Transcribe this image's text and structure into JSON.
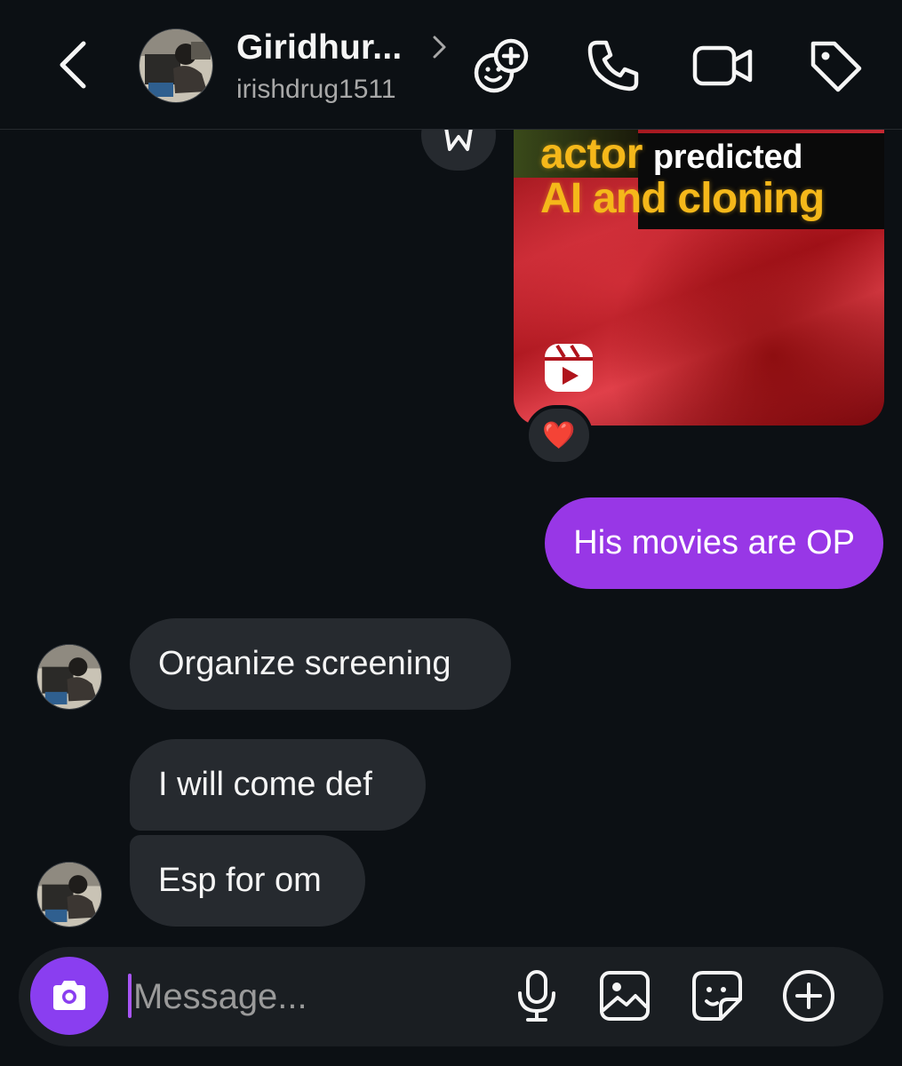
{
  "header": {
    "name": "Giridhur...",
    "username": "irishdrug1511",
    "icons": [
      "back-chevron-icon",
      "chevron-right-icon",
      "gaming-icon",
      "phone-icon",
      "video-camera-icon",
      "tag-icon"
    ]
  },
  "reel": {
    "word_actor": "actor",
    "word_predicted": "predicted",
    "line_two": "AI and cloning",
    "icon": "reels-icon"
  },
  "reaction": {
    "emoji": "❤️"
  },
  "messages": {
    "outgoing": [
      {
        "text": "His movies are OP"
      }
    ],
    "incoming": [
      {
        "text": "Organize screening"
      },
      {
        "text": "I will come def"
      },
      {
        "text": "Esp for om"
      }
    ]
  },
  "composer": {
    "placeholder": "Message...",
    "icons": [
      "camera-icon",
      "microphone-icon",
      "image-icon",
      "sticker-icon",
      "plus-circle-icon"
    ]
  },
  "colors": {
    "background": "#0c1014",
    "outgoing_bubble": "#9837e6",
    "incoming_bubble": "#262a2f",
    "camera_button": "#8a3ef0",
    "reel_yellow": "#f5b81a"
  }
}
